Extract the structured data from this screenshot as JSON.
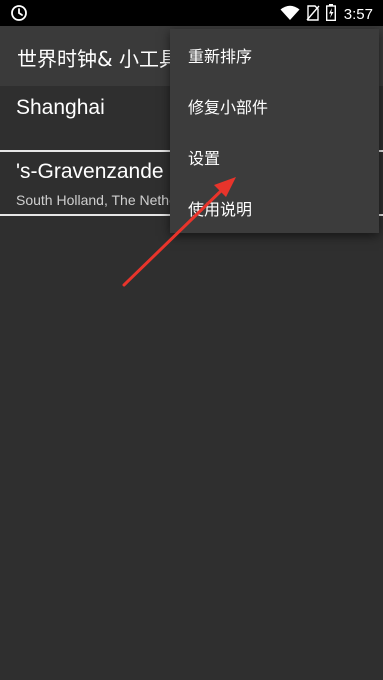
{
  "status_bar": {
    "time": "3:57",
    "left_icon": "alarm-clock-icon",
    "right_icons": [
      "wifi-icon",
      "no-sim-icon",
      "battery-charging-icon"
    ]
  },
  "app_bar": {
    "title": "世界时钟& 小工具"
  },
  "cities": [
    {
      "name": "Shanghai",
      "subtitle": ""
    },
    {
      "name": "'s-Gravenzande",
      "subtitle": "South Holland, The Netherlands"
    }
  ],
  "overflow_menu": {
    "items": [
      {
        "label": "重新排序"
      },
      {
        "label": "修复小部件"
      },
      {
        "label": "设置"
      },
      {
        "label": "使用说明"
      }
    ]
  },
  "colors": {
    "background": "#2f2f2f",
    "app_bar": "#3a3a3a",
    "menu": "#3c3c3c",
    "annotation_arrow": "#e8342b"
  }
}
